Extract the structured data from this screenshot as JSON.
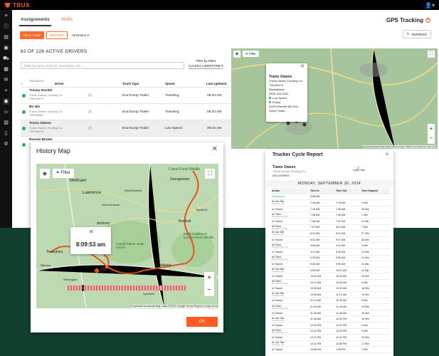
{
  "app": {
    "brand": "TRUX",
    "user_icon": "user-icon"
  },
  "sidebar": {
    "icons": [
      "hamburger-icon",
      "info-icon",
      "clipboard-icon",
      "box-icon",
      "truck-icon",
      "grid-icon",
      "mail-icon",
      "location-icon",
      "gps-icon",
      "card-icon",
      "chart-icon",
      "document-icon",
      "gear-icon"
    ]
  },
  "tabs": [
    {
      "label": "Assignments"
    },
    {
      "label": "Shifts"
    }
  ],
  "page_title": "GPS Tracking",
  "mode": {
    "realtime": "REAL-TIME",
    "history": "HISTORY",
    "drivers_filter": "All Drivers ▾"
  },
  "refresh_label": "REFRESH",
  "drivers_count": "62 OF 226 ACTIVE DRIVERS",
  "search_placeholder": "Filter by name, truck ID, description, etc...",
  "plant_filter": {
    "label": "Filter by Plant",
    "value": "CALERA LIMESTONE ▾"
  },
  "columns": {
    "driver": "Driver",
    "truck_type": "Truck Type",
    "speed": "Speed",
    "last_updated": "Last Updated"
  },
  "drivers": [
    {
      "name": "TRUX6190",
      "company": "",
      "id": "",
      "truck_type": "",
      "speed": "",
      "updated": ""
    },
    {
      "name": "Tracey Rocker",
      "company": "Travis Owens Trucking Co",
      "id": "TRUX6979",
      "truck_type": "End Dump Trailer",
      "speed": "Traveling",
      "updated": "08:33 AM"
    },
    {
      "name": "Bo Nix",
      "company": "Travis Owens Trucking Co",
      "id": "TRUX6980",
      "truck_type": "End Dump Trailer",
      "speed": "Traveling",
      "updated": "08:33 AM"
    },
    {
      "name": "Travis Owens",
      "company": "Travis Owens Trucking Co",
      "id": "TRUX6475",
      "truck_type": "End Dump Trailer",
      "speed": "Low Speed",
      "updated": "08:33 AM"
    },
    {
      "name": "Ronnie Brown",
      "company": "Travis Owens Trucking Co",
      "id": "TRUX6986",
      "truck_type": "End Dump Trailer",
      "speed": "Traveling",
      "updated": "08:33 AM"
    }
  ],
  "map_popup": {
    "name": "Travis Owens",
    "company": "Travis Owens Trucking Co",
    "id": "TRUX6475",
    "plant": "Marketplace",
    "phone": "(205) 444-3333",
    "status1": "Low Speed",
    "status2": "Empty",
    "truck": "2020 Peterbilt 389 End Dump Trailer"
  },
  "map_controls": {
    "filter": "Filter",
    "attribution": "Keyboard shortcuts  Map data ©2024 Google, INEGI  Terms  Report a map error"
  },
  "history_modal": {
    "title": "History Map",
    "time": "8:09:53 am",
    "ok": "OK",
    "attribution": "Keyboard shortcuts  Map data ©2024 Google  Terms  Report a map error",
    "places": [
      "Crane Pond Wildlife",
      "Georgetown",
      "Methuen",
      "Lawrence",
      "West Boxford",
      "Andover",
      "North Andover",
      "Boxford",
      "Harold Parker State Forest",
      "Middleton",
      "Mass Audubon's Ipswich River Wildlife",
      "Tewksbury",
      "Wilmington",
      "Billerica",
      "North Reading",
      "Topsfield",
      "Lynnfield"
    ]
  },
  "report": {
    "title": "Trucker Cycle Report",
    "driver": "Travis Owens",
    "company": "Travis Owens Trucking Co",
    "role": "DELIVERIES",
    "location": "Lynn, MA",
    "date": "MONDAY, SEPTEMBER 30, 2024",
    "headers": [
      "Action",
      "Time In",
      "Time Out",
      "Time Elapsed"
    ],
    "rows": [
      [
        "Punched In",
        "",
        "6:56 AM",
        "",
        ""
      ],
      [
        "At Job Site",
        "Tewksbury, MA",
        "7:16 AM",
        "7:16 AM",
        "1 Min"
      ],
      [
        "In Transit",
        "",
        "7:16 AM",
        "7:45 AM",
        "29 Min"
      ],
      [
        "At Plant",
        "WILMINGTON, MA",
        "7:36 AM",
        "7:46 AM",
        "1 Min"
      ],
      [
        "In Transit",
        "",
        "7:46 AM",
        "7:57 AM",
        "11 Min"
      ],
      [
        "At Plant",
        "WILMINGTON, MA",
        "7:57 AM",
        "8:04 AM",
        "7 Min"
      ],
      [
        "At Job Site",
        "Tewksbury, MA",
        "8:04 AM",
        "8:31 AM",
        "27 Min"
      ],
      [
        "In Transit",
        "",
        "8:31 AM",
        "9:07 AM",
        "36 Min"
      ],
      [
        "At Plant",
        "WILMINGTON, MA",
        "9:08 AM",
        "9:11 AM",
        "3 Min"
      ],
      [
        "In Transit",
        "",
        "9:11 AM",
        "9:25 AM",
        "14 Min"
      ],
      [
        "At Plant",
        "WILMINGTON, MA",
        "9:25 AM",
        "9:39 AM",
        "14 Min"
      ],
      [
        "In Transit",
        "",
        "9:39 AM",
        "9:50 AM",
        "11 Min"
      ],
      [
        "At Job Site",
        "Tewksbury, MA",
        "9:50 AM",
        "10:01 AM",
        "11 Min"
      ],
      [
        "In Transit",
        "",
        "10:01 AM",
        "10:19 AM",
        "18 Min"
      ],
      [
        "At Plant",
        "WILMINGTON, MA",
        "10:21 AM",
        "10:26 AM",
        "5 Min"
      ],
      [
        "In Transit",
        "",
        "10:26 AM",
        "10:42 AM",
        "16 Min"
      ],
      [
        "At Job Site",
        "Tewksbury, MA",
        "10:56 AM",
        "11:12 AM",
        "16 Min"
      ],
      [
        "In Transit",
        "",
        "11:12 AM",
        "11:20 AM",
        "8 Min"
      ],
      [
        "At Plant",
        "WILMINGTON, MA",
        "11:20 AM",
        "11:30 AM",
        "10 Min"
      ],
      [
        "In Transit",
        "",
        "11:30 AM",
        "11:46 AM",
        "16 Min"
      ],
      [
        "At Job Site",
        "Tewksbury, MA",
        "11:46 AM",
        "12:02 PM",
        "16 Min"
      ],
      [
        "In Transit",
        "",
        "12:02 PM",
        "12:11 PM",
        "9 Min"
      ],
      [
        "At Plant",
        "WILMINGTON, MA",
        "12:11 PM",
        "12:20 PM",
        "9 Min"
      ],
      [
        "In Transit",
        "",
        "12:21 PM",
        "12:41 PM",
        "20 Min"
      ],
      [
        "At Job Site",
        "Tewksbury, MA",
        "12:41 PM",
        "12:58 PM",
        "17 Min"
      ],
      [
        "In Transit",
        "",
        "12:58 PM",
        "1:05 PM",
        "7 Min"
      ]
    ]
  },
  "colors": {
    "accent": "#ff5a1f",
    "online": "#2fa84f",
    "route": "#e8531c"
  }
}
